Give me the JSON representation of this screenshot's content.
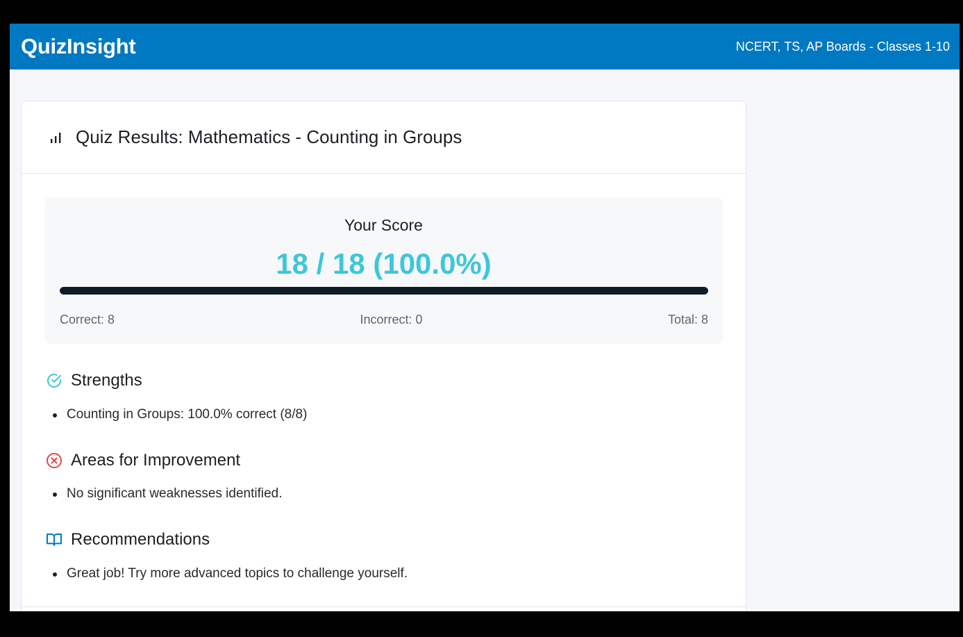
{
  "header": {
    "brand": "QuizInsight",
    "boards": "NCERT, TS, AP Boards - Classes 1-10"
  },
  "results": {
    "title": "Quiz Results: Mathematics - Counting in Groups",
    "title_icon": "bar-chart-icon",
    "score_label": "Your Score",
    "score_value": "18 / 18 (100.0%)",
    "progress_percent": 100,
    "correct": "Correct: 8",
    "incorrect": "Incorrect: 0",
    "total": "Total: 8"
  },
  "strengths": {
    "icon": "check-circle-icon",
    "title": "Strengths",
    "items": [
      "Counting in Groups: 100.0% correct (8/8)"
    ]
  },
  "improvement": {
    "icon": "x-circle-icon",
    "title": "Areas for Improvement",
    "items": [
      "No significant weaknesses identified."
    ]
  },
  "recommendations": {
    "icon": "book-icon",
    "title": "Recommendations",
    "items": [
      "Great job! Try more advanced topics to challenge yourself."
    ]
  },
  "colors": {
    "topbar": "#0078c2",
    "score": "#3ec6d9",
    "progress": "#0c1a2a",
    "strength_icon": "#3ec6d9",
    "improvement_icon": "#e04848",
    "recommendation_icon": "#0078c2"
  }
}
